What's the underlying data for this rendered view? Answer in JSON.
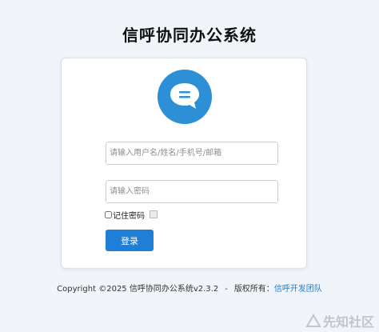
{
  "header": {
    "title": "信呼协同办公系统"
  },
  "logo": {
    "icon": "chat-bubble-icon",
    "color": "#2d8fd5"
  },
  "form": {
    "username_placeholder": "请输入用户名/姓名/手机号/邮箱",
    "username_value": "",
    "password_placeholder": "请输入密码",
    "password_value": "",
    "remember_label": "记住密码",
    "remember_checked": false,
    "login_button_label": "登录",
    "accent_color": "#1f7fd6"
  },
  "footer": {
    "copyright": "Copyright ©2025 信呼协同办公系统v2.3.2",
    "separator": "-",
    "rights_prefix": "版权所有：",
    "rights_link": "信呼开发团队"
  },
  "watermark": {
    "text": "先知社区"
  }
}
